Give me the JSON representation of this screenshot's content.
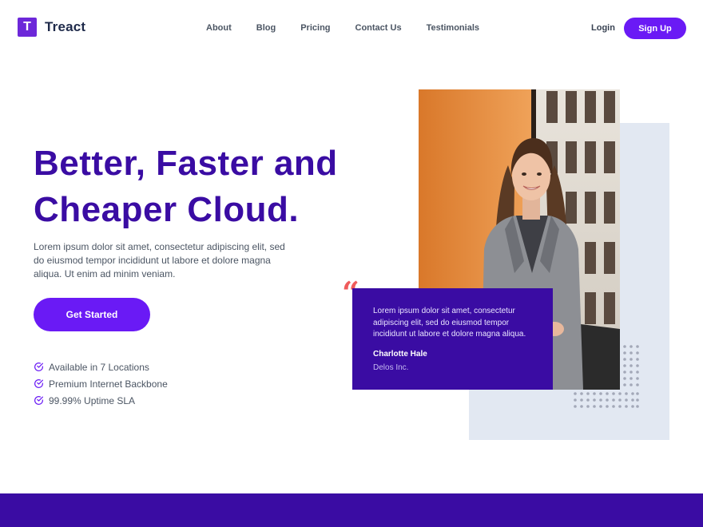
{
  "brand": {
    "logo_letter": "T",
    "name": "Treact",
    "accent": "#6a1af5",
    "primary_dark": "#3a0ca3"
  },
  "nav": {
    "items": [
      {
        "label": "About"
      },
      {
        "label": "Blog"
      },
      {
        "label": "Pricing"
      },
      {
        "label": "Contact Us"
      },
      {
        "label": "Testimonials"
      }
    ],
    "login_label": "Login",
    "signup_label": "Sign Up"
  },
  "hero": {
    "headline_line1": "Better, Faster and",
    "headline_line2": "Cheaper Cloud.",
    "description": "Lorem ipsum dolor sit amet, consectetur adipiscing elit, sed do eiusmod tempor incididunt ut labore et dolore magna aliqua. Ut enim ad minim veniam.",
    "cta_label": "Get Started",
    "features": [
      {
        "icon": "check-circle-icon",
        "label": "Available in 7 Locations"
      },
      {
        "icon": "check-circle-icon",
        "label": "Premium Internet Backbone"
      },
      {
        "icon": "check-circle-icon",
        "label": "99.99% Uptime SLA"
      }
    ]
  },
  "testimonial": {
    "quote_mark": "“",
    "text": "Lorem ipsum dolor sit amet, consectetur adipiscing elit, sed do eiusmod tempor incididunt ut labore et dolore magna aliqua.",
    "author": "Charlotte Hale",
    "company": "Delos Inc."
  }
}
